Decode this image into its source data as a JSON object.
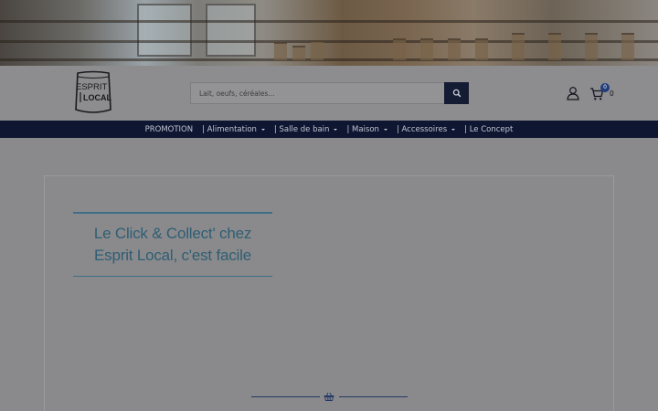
{
  "header": {
    "logo_text_top": "ESPRIT",
    "logo_text_bottom": "LOCAL",
    "search_placeholder": "Lait, oeufs, céréales...",
    "cart_badge": "0",
    "cart_count": "0"
  },
  "nav": {
    "items": [
      {
        "label": "PROMOTION",
        "dropdown": false
      },
      {
        "label": "| Alimentation",
        "dropdown": true
      },
      {
        "label": "| Salle de bain",
        "dropdown": true
      },
      {
        "label": "| Maison",
        "dropdown": true
      },
      {
        "label": "| Accessoires",
        "dropdown": true
      },
      {
        "label": "| Le Concept",
        "dropdown": false
      }
    ]
  },
  "main": {
    "title": "Le Click & Collect' chez Esprit Local, c'est facile"
  },
  "colors": {
    "nav_bg": "#0e1631",
    "accent_teal": "#2f5e73",
    "search_button": "#141c33",
    "badge": "#1f3d7a"
  },
  "icons": [
    "search-icon",
    "user-icon",
    "cart-icon",
    "basket-icon"
  ]
}
